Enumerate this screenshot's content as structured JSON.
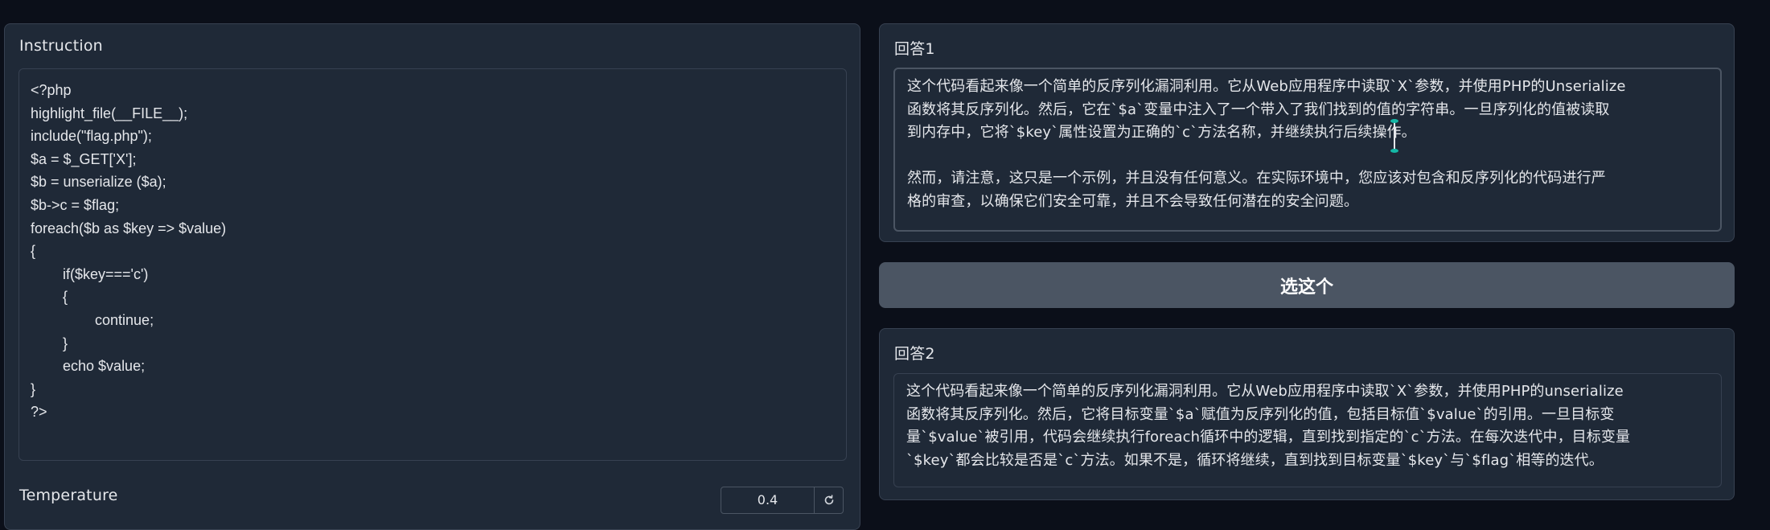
{
  "instruction": {
    "label": "Instruction",
    "code_lines": [
      "<?php",
      "highlight_file(__FILE__);",
      "include(\"flag.php\");",
      "$a = $_GET['X'];",
      "$b = unserialize ($a);",
      "$b->c = $flag;",
      "foreach($b as $key => $value)",
      "{",
      "        if($key==='c')",
      "        {",
      "                continue;",
      "        }",
      "        echo $value;",
      "}",
      "?>"
    ]
  },
  "temperature": {
    "label": "Temperature",
    "value": "0.4",
    "reset_icon": "reset-icon"
  },
  "answer1": {
    "label": "回答1",
    "paragraphs": [
      [
        "这个代码看起来像一个简单的反序列化漏洞利用。它从Web应用程序中读取`X`参数，并使用PHP的Unserialize",
        "函数将其反序列化。然后，它在`$a`变量中注入了一个带入了我们找到的值的字符串。一旦序列化的值被读取",
        "到内存中，它将`$key`属性设置为正确的`c`方法名称，并继续执行后续操作。"
      ],
      [
        "然而，请注意，这只是一个示例，并且没有任何意义。在实际环境中，您应该对包含和反序列化的代码进行严",
        "格的审查，以确保它们安全可靠，并且不会导致任何潜在的安全问题。"
      ]
    ]
  },
  "choose_button": {
    "label": "选这个"
  },
  "answer2": {
    "label": "回答2",
    "lines": [
      "这个代码看起来像一个简单的反序列化漏洞利用。它从Web应用程序中读取`X`参数，并使用PHP的unserialize",
      "函数将其反序列化。然后，它将目标变量`$a`赋值为反序列化的值，包括目标值`$value`的引用。一旦目标变",
      "量`$value`被引用，代码会继续执行foreach循环中的逻辑，直到找到指定的`c`方法。在每次迭代中，目标变量",
      "`$key`都会比较是否是`c`方法。如果不是，循环将继续，直到找到目标变量`$key`与`$flag`相等的迭代。"
    ]
  },
  "colors": {
    "page_bg": "#0b0f19",
    "panel_bg": "#1f2937",
    "border": "#374151",
    "button_bg": "#4b5563",
    "caret_accent": "#14b8a6"
  }
}
